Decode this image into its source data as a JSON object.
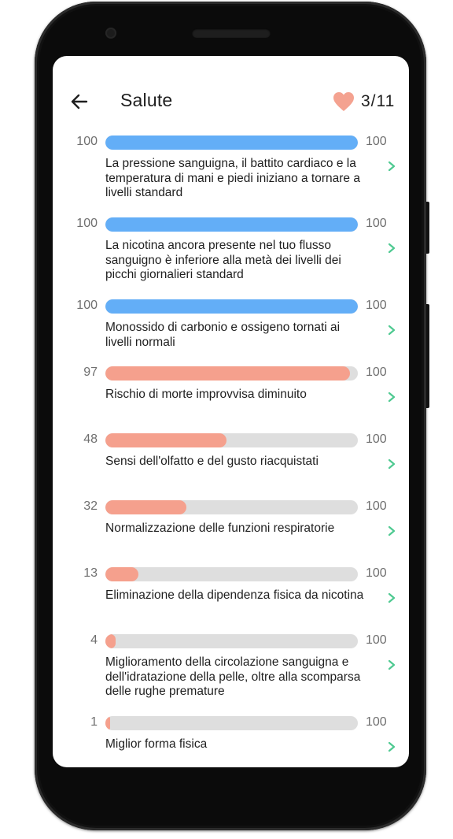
{
  "header": {
    "title": "Salute",
    "lives": "3/11"
  },
  "colors": {
    "complete": "#63aef7",
    "progress": "#f5a08d",
    "track": "#dedede",
    "chevron": "#4dc990",
    "heart": "#f4a290"
  },
  "items": [
    {
      "current": "100",
      "max": "100",
      "progress": 1.0,
      "status": "complete",
      "text": "La pressione sanguigna, il battito cardiaco e la temperatura di mani e piedi iniziano a tornare a livelli standard"
    },
    {
      "current": "100",
      "max": "100",
      "progress": 1.0,
      "status": "complete",
      "text": "La nicotina ancora presente nel tuo flusso sanguigno è inferiore alla metà dei livelli dei picchi giornalieri standard"
    },
    {
      "current": "100",
      "max": "100",
      "progress": 1.0,
      "status": "complete",
      "text": "Monossido di carbonio e ossigeno tornati ai livelli normali"
    },
    {
      "current": "97",
      "max": "100",
      "progress": 0.97,
      "status": "progress",
      "text": "Rischio di morte improvvisa diminuito"
    },
    {
      "current": "48",
      "max": "100",
      "progress": 0.48,
      "status": "progress",
      "text": "Sensi dell'olfatto e del gusto riacquistati"
    },
    {
      "current": "32",
      "max": "100",
      "progress": 0.32,
      "status": "progress",
      "text": "Normalizzazione delle funzioni respiratorie"
    },
    {
      "current": "13",
      "max": "100",
      "progress": 0.13,
      "status": "progress",
      "text": "Eliminazione della dipendenza fisica da nicotina"
    },
    {
      "current": "4",
      "max": "100",
      "progress": 0.04,
      "status": "progress",
      "text": "Miglioramento della circolazione sanguigna e dell'idratazione della pelle, oltre alla scomparsa delle rughe premature"
    },
    {
      "current": "1",
      "max": "100",
      "progress": 0.01,
      "status": "progress",
      "text": "Miglior forma fisica"
    }
  ]
}
